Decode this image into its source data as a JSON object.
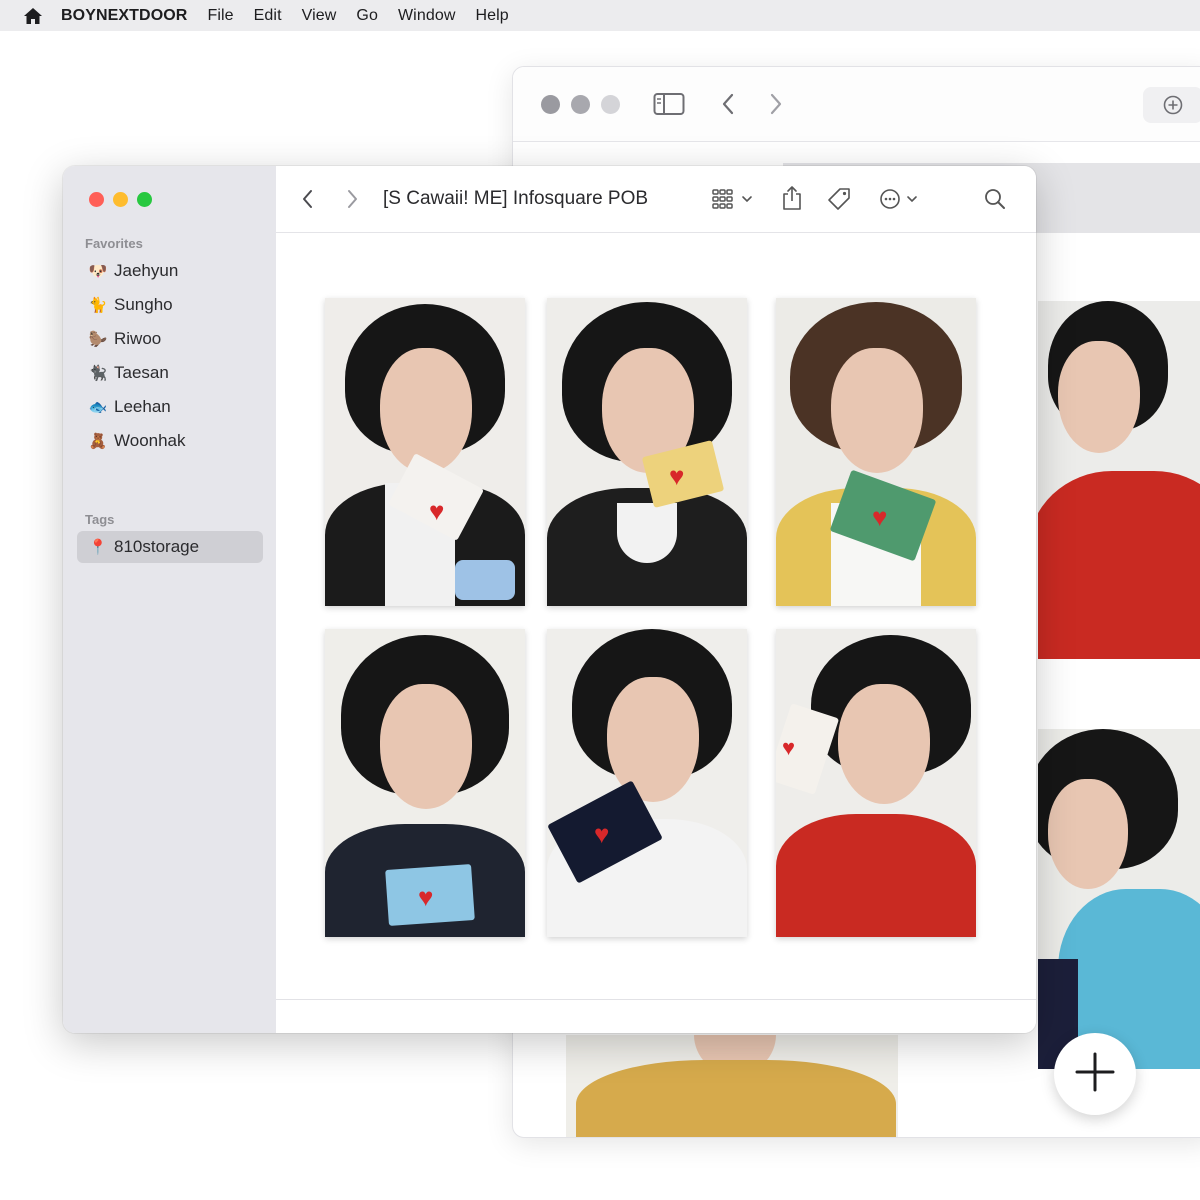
{
  "menubar": {
    "app_name": "BOYNEXTDOOR",
    "items": [
      "File",
      "Edit",
      "View",
      "Go",
      "Window",
      "Help"
    ]
  },
  "finder": {
    "title": "[S Cawaii! ME] Infosquare POB",
    "sidebar": {
      "favorites_title": "Favorites",
      "favorites": [
        {
          "emoji": "🐶",
          "label": "Jaehyun"
        },
        {
          "emoji": "🐈",
          "label": "Sungho"
        },
        {
          "emoji": "🦫",
          "label": "Riwoo"
        },
        {
          "emoji": "🐈‍⬛",
          "label": "Taesan"
        },
        {
          "emoji": "🐟",
          "label": "Leehan"
        },
        {
          "emoji": "🧸",
          "label": "Woonhak"
        }
      ],
      "tags_title": "Tags",
      "tags": [
        {
          "emoji": "📍",
          "label": "810storage",
          "selected": true
        }
      ]
    }
  },
  "colors": {
    "close": "#ff5f57",
    "minimize": "#febc2e",
    "zoom": "#28c840",
    "inactive_dot": "#9a9aa0",
    "heart": "#d8282a"
  },
  "icons": [
    "apple-menu-icon",
    "sidebar-toggle-icon",
    "chevron-left-icon",
    "chevron-right-icon",
    "grid-view-icon",
    "share-icon",
    "tag-icon",
    "more-icon",
    "search-icon",
    "add-icon",
    "plus-icon"
  ]
}
